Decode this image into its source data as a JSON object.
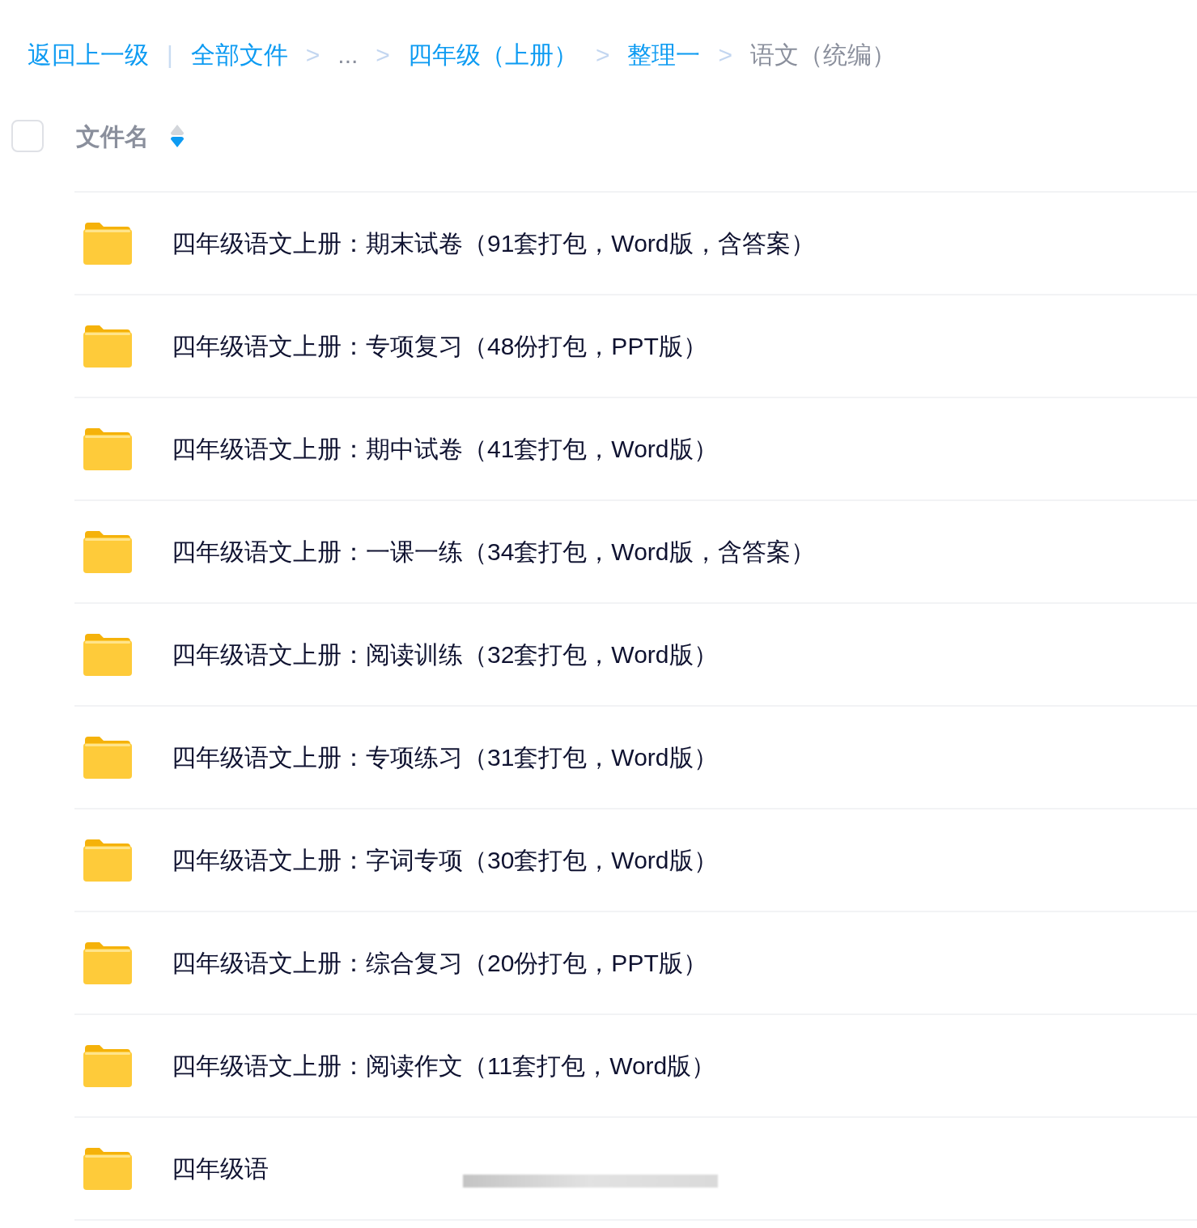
{
  "breadcrumb": {
    "back": "返回上一级",
    "divider": "|",
    "items": [
      {
        "label": "全部文件",
        "kind": "link",
        "separator": ">"
      },
      {
        "label": "...",
        "kind": "ellipsis",
        "separator": ">"
      },
      {
        "label": "四年级（上册）",
        "kind": "link",
        "separator": ">"
      },
      {
        "label": "整理一",
        "kind": "link",
        "separator": ">"
      },
      {
        "label": "语文（统编）",
        "kind": "current"
      }
    ]
  },
  "header": {
    "checked": false,
    "column": "文件名",
    "sort_descending": true
  },
  "rows": [
    {
      "name": "四年级语文上册：期末试卷（91套打包，Word版，含答案）"
    },
    {
      "name": "四年级语文上册：专项复习（48份打包，PPT版）"
    },
    {
      "name": "四年级语文上册：期中试卷（41套打包，Word版）"
    },
    {
      "name": "四年级语文上册：一课一练（34套打包，Word版，含答案）"
    },
    {
      "name": "四年级语文上册：阅读训练（32套打包，Word版）"
    },
    {
      "name": "四年级语文上册：专项练习（31套打包，Word版）"
    },
    {
      "name": "四年级语文上册：字词专项（30套打包，Word版）"
    },
    {
      "name": "四年级语文上册：综合复习（20份打包，PPT版）"
    },
    {
      "name": "四年级语文上册：阅读作文（11套打包，Word版）"
    },
    {
      "name": "四年级语",
      "blurred": true
    }
  ]
}
